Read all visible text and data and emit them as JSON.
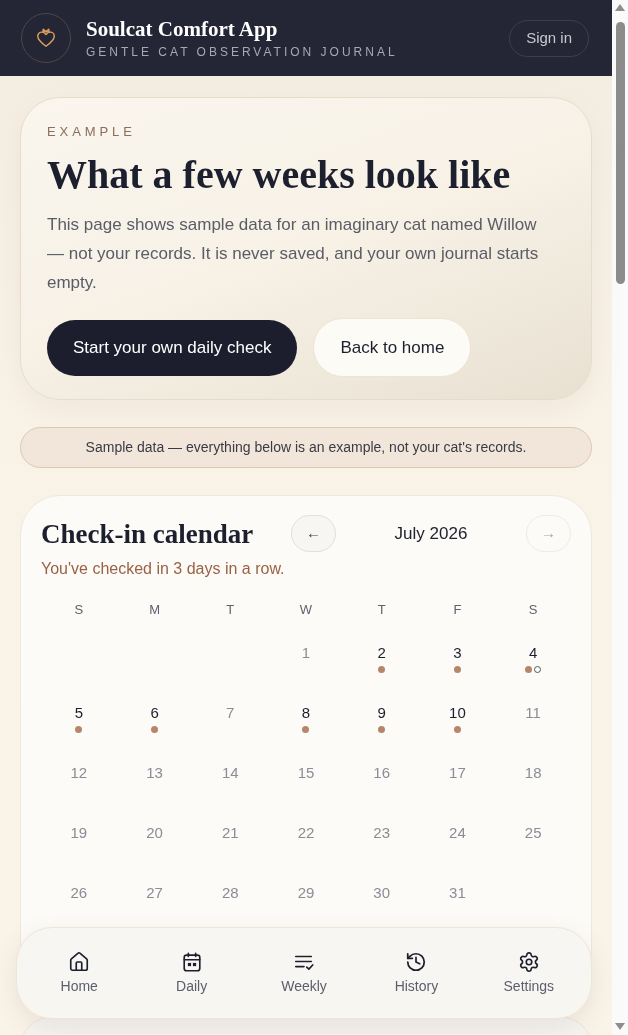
{
  "header": {
    "title": "Soulcat Comfort App",
    "subtitle": "GENTLE CAT OBSERVATION JOURNAL",
    "sign_in": "Sign in"
  },
  "hero": {
    "eyebrow": "EXAMPLE",
    "title": "What a few weeks look like",
    "body": "This page shows sample data for an imaginary cat named Willow — not your records. It is never saved, and your own journal starts empty.",
    "buttons": [
      {
        "label": "Start your own daily check",
        "kind": "primary"
      },
      {
        "label": "Back to home",
        "kind": "secondary"
      }
    ]
  },
  "notice": "Sample data — everything below is an example, not your cat's records.",
  "calendar": {
    "title": "Check-in calendar",
    "prev": {
      "label": "←",
      "disabled": false
    },
    "month": "July 2026",
    "next": {
      "label": "→",
      "disabled": true
    },
    "streak": "You've checked in 3 days in a row.",
    "weekdays": [
      "S",
      "M",
      "T",
      "W",
      "T",
      "F",
      "S"
    ],
    "weeks": [
      {
        "days": [
          {
            "day": "1",
            "checked_in": false
          },
          {
            "day": "2",
            "checked_in": true,
            "markers": [
              {
                "kind": "filled"
              }
            ]
          },
          {
            "day": "3",
            "checked_in": true,
            "markers": [
              {
                "kind": "filled"
              }
            ]
          },
          {
            "day": "4",
            "checked_in": true,
            "markers": [
              {
                "kind": "filled"
              },
              {
                "kind": "hollow"
              }
            ]
          }
        ]
      },
      {
        "days": [
          {
            "day": "5",
            "checked_in": true,
            "markers": [
              {
                "kind": "filled"
              }
            ]
          },
          {
            "day": "6",
            "checked_in": true,
            "markers": [
              {
                "kind": "filled"
              }
            ]
          },
          {
            "day": "7",
            "checked_in": false
          },
          {
            "day": "8",
            "checked_in": true,
            "markers": [
              {
                "kind": "filled"
              }
            ]
          },
          {
            "day": "9",
            "checked_in": true,
            "markers": [
              {
                "kind": "filled"
              }
            ]
          },
          {
            "day": "10",
            "checked_in": true,
            "markers": [
              {
                "kind": "filled"
              }
            ]
          },
          {
            "day": "11",
            "checked_in": false
          }
        ]
      },
      {
        "days": [
          {
            "day": "12",
            "checked_in": false
          },
          {
            "day": "13",
            "checked_in": false
          },
          {
            "day": "14",
            "checked_in": false
          },
          {
            "day": "15",
            "checked_in": false
          },
          {
            "day": "16",
            "checked_in": false
          },
          {
            "day": "17",
            "checked_in": false
          },
          {
            "day": "18",
            "checked_in": false
          }
        ]
      },
      {
        "days": [
          {
            "day": "19",
            "checked_in": false
          },
          {
            "day": "20",
            "checked_in": false
          },
          {
            "day": "21",
            "checked_in": false
          },
          {
            "day": "22",
            "checked_in": false
          },
          {
            "day": "23",
            "checked_in": false
          },
          {
            "day": "24",
            "checked_in": false
          },
          {
            "day": "25",
            "checked_in": false
          }
        ]
      },
      {
        "days": [
          {
            "day": "26",
            "checked_in": false
          },
          {
            "day": "27",
            "checked_in": false
          },
          {
            "day": "28",
            "checked_in": false
          },
          {
            "day": "29",
            "checked_in": false
          },
          {
            "day": "30",
            "checked_in": false
          },
          {
            "day": "31",
            "checked_in": false
          }
        ]
      }
    ]
  },
  "nav": [
    {
      "label": "Home"
    },
    {
      "label": "Daily"
    },
    {
      "label": "Weekly"
    },
    {
      "label": "History"
    },
    {
      "label": "Settings"
    }
  ]
}
